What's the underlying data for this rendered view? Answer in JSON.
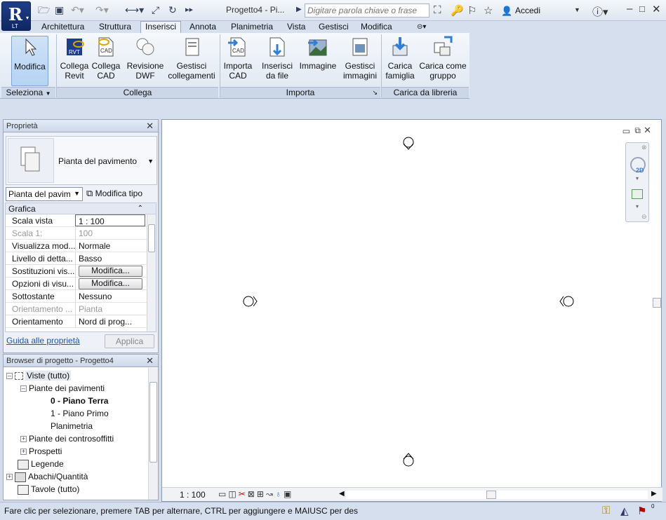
{
  "app": {
    "title": "Progetto4 - Pi...",
    "logo_letter": "R",
    "edition": "LT"
  },
  "search": {
    "placeholder": "Digitare parola chiave o frase"
  },
  "signin": {
    "label": "Accedi"
  },
  "tabs": [
    "Architettura",
    "Struttura",
    "Inserisci",
    "Annota",
    "Planimetria",
    "Vista",
    "Gestisci",
    "Modifica"
  ],
  "active_tab": "Inserisci",
  "ribbon": {
    "modifica": "Modifica",
    "collega_revit": [
      "Collega",
      "Revit"
    ],
    "collega_cad": [
      "Collega",
      "CAD"
    ],
    "revisione_dwf": [
      "Revisione",
      "DWF"
    ],
    "gestisci_coll": [
      "Gestisci",
      "collegamenti"
    ],
    "importa_cad": [
      "Importa",
      "CAD"
    ],
    "inserisci_file": [
      "Inserisci",
      "da file"
    ],
    "immagine": "Immagine",
    "gestisci_img": [
      "Gestisci",
      "immagini"
    ],
    "carica_fam": [
      "Carica",
      "famiglia"
    ],
    "carica_gruppo": [
      "Carica come",
      "gruppo"
    ],
    "panels": {
      "seleziona": "Seleziona",
      "collega": "Collega",
      "importa": "Importa",
      "carica": "Carica da libreria"
    },
    "icon_text": {
      "rvt": "RVT",
      "cad": "CAD"
    }
  },
  "properties": {
    "title": "Proprietà",
    "type_name": "Pianta del pavimento",
    "filter": "Pianta del pavim",
    "edit_type": "Modifica tipo",
    "group": "Grafica",
    "rows": [
      {
        "k": "Scala vista",
        "v": "1 : 100"
      },
      {
        "k": "Scala  1:",
        "v": "100"
      },
      {
        "k": "Visualizza mod...",
        "v": "Normale"
      },
      {
        "k": "Livello di detta...",
        "v": "Basso"
      },
      {
        "k": "Sostituzioni vis...",
        "v": "Modifica..."
      },
      {
        "k": "Opzioni di visu...",
        "v": "Modifica..."
      },
      {
        "k": "Sottostante",
        "v": "Nessuno"
      },
      {
        "k": "Orientamento ...",
        "v": "Pianta"
      },
      {
        "k": "Orientamento",
        "v": "Nord di prog..."
      }
    ],
    "help_link": "Guida alle proprietà",
    "apply": "Applica"
  },
  "browser": {
    "title": "Browser di progetto - Progetto4",
    "items": [
      "Viste (tutto)",
      "Piante dei pavimenti",
      "0 - Piano Terra",
      "1 - Piano Primo",
      "Planimetria",
      "Piante dei controsoffitti",
      "Prospetti",
      "Legende",
      "Abachi/Quantità",
      "Tavole (tutto)"
    ]
  },
  "viewcontrol": {
    "scale": "1 : 100"
  },
  "nav": {
    "label_2d": "2D"
  },
  "status": {
    "text": "Fare clic per selezionare, premere TAB per alternare, CTRL per aggiungere e MAIUSC per des",
    "filter_count": "0"
  }
}
